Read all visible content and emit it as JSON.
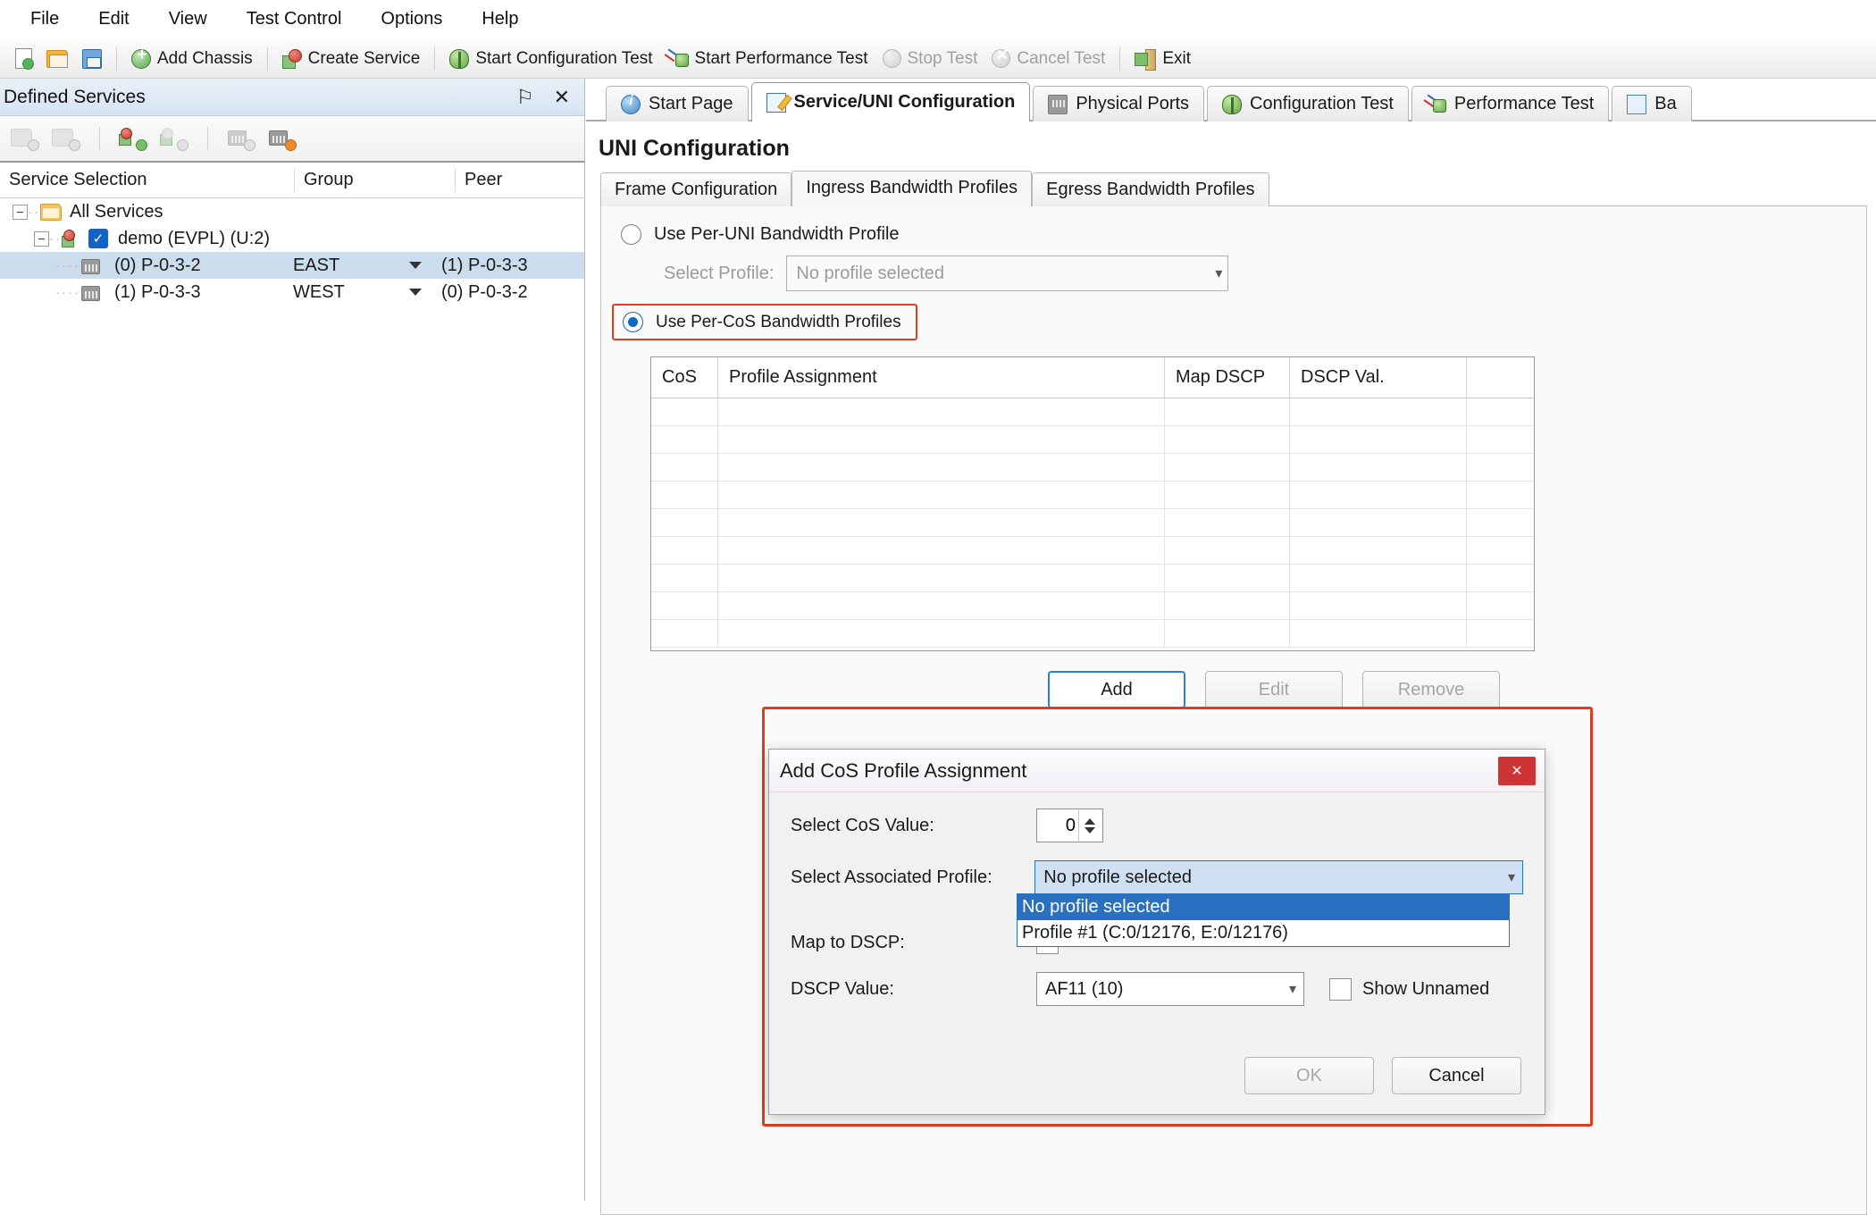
{
  "menubar": {
    "items": [
      "File",
      "Edit",
      "View",
      "Test Control",
      "Options",
      "Help"
    ]
  },
  "toolbar": {
    "items": [
      {
        "label": "",
        "icon": "new-document-icon",
        "enabled": true
      },
      {
        "label": "",
        "icon": "open-folder-icon",
        "enabled": true
      },
      {
        "label": "",
        "icon": "save-icon",
        "enabled": true
      },
      {
        "label": "Add Chassis",
        "icon": "add-chassis-icon",
        "enabled": true
      },
      {
        "label": "Create Service",
        "icon": "create-service-icon",
        "enabled": true
      },
      {
        "label": "Start Configuration Test",
        "icon": "start-configuration-test-icon",
        "enabled": true
      },
      {
        "label": "Start Performance Test",
        "icon": "start-performance-test-icon",
        "enabled": true
      },
      {
        "label": "Stop Test",
        "icon": "stop-test-icon",
        "enabled": false
      },
      {
        "label": "Cancel Test",
        "icon": "cancel-test-icon",
        "enabled": false
      },
      {
        "label": "Exit",
        "icon": "exit-icon",
        "enabled": true
      }
    ]
  },
  "left_panel": {
    "title": "Defined Services",
    "pin_glyph": "⚐",
    "close_glyph": "✕",
    "columns": [
      "Service Selection",
      "Group",
      "Peer"
    ],
    "tree": [
      {
        "label": "All Services",
        "icon": "folder-icon",
        "depth": 0,
        "expanded": true,
        "group": "",
        "peer": "",
        "selected": false
      },
      {
        "label": "demo (EVPL) (U:2)",
        "icon": "service-icon",
        "depth": 1,
        "expanded": true,
        "checked": true,
        "group": "",
        "peer": "",
        "selected": false
      },
      {
        "label": "(0) P-0-3-2",
        "icon": "chassis-icon",
        "depth": 2,
        "group": "EAST",
        "peer": "(1) P-0-3-3",
        "selected": true
      },
      {
        "label": "(1) P-0-3-3",
        "icon": "chassis-icon",
        "depth": 2,
        "group": "WEST",
        "peer": "(0) P-0-3-2",
        "selected": false
      }
    ]
  },
  "tabs": [
    {
      "label": "Start Page",
      "icon": "info-icon",
      "active": false
    },
    {
      "label": "Service/UNI Configuration",
      "icon": "pencil-icon",
      "active": true
    },
    {
      "label": "Physical Ports",
      "icon": "chassis-icon",
      "active": false
    },
    {
      "label": "Configuration Test",
      "icon": "bug-icon",
      "active": false
    },
    {
      "label": "Performance Test",
      "icon": "performance-icon",
      "active": false
    },
    {
      "label": "Ba",
      "icon": "page-icon",
      "active": false
    }
  ],
  "main": {
    "page_title": "UNI Configuration",
    "subtabs": [
      {
        "label": "Frame Configuration",
        "active": false
      },
      {
        "label": "Ingress Bandwidth Profiles",
        "active": true
      },
      {
        "label": "Egress Bandwidth Profiles",
        "active": false
      }
    ],
    "per_uni": {
      "radio_label": "Use Per-UNI Bandwidth Profile",
      "selected": false,
      "select_profile_label": "Select Profile:",
      "select_profile_value": "No profile selected"
    },
    "per_cos": {
      "radio_label": "Use Per-CoS Bandwidth Profiles",
      "selected": true,
      "highlighted": true
    },
    "table": {
      "columns": [
        "CoS",
        "Profile Assignment",
        "Map DSCP",
        "DSCP Val.",
        ""
      ],
      "rows": []
    },
    "buttons": [
      {
        "label": "Add",
        "enabled": true,
        "primary": true
      },
      {
        "label": "Edit",
        "enabled": false,
        "primary": false
      },
      {
        "label": "Remove",
        "enabled": false,
        "primary": false
      }
    ]
  },
  "dialog": {
    "title": "Add CoS Profile Assignment",
    "close_glyph": "×",
    "highlighted": true,
    "cos_value_label": "Select CoS Value:",
    "cos_value": "0",
    "associated_profile_label": "Select Associated Profile:",
    "associated_profile_value": "No profile selected",
    "dropdown_open": true,
    "dropdown_options": [
      {
        "label": "No profile selected",
        "selected": true
      },
      {
        "label": "Profile #1 (C:0/12176, E:0/12176)",
        "selected": false
      }
    ],
    "map_to_dscp_label": "Map to DSCP:",
    "map_to_dscp_checked": false,
    "dscp_value_label": "DSCP Value:",
    "dscp_value": "AF11 (10)",
    "show_unnamed_label": "Show Unnamed",
    "show_unnamed_checked": false,
    "ok_label": "OK",
    "ok_enabled": false,
    "cancel_label": "Cancel"
  },
  "colors": {
    "highlight_red": "#e03c1e",
    "selection_blue": "#2a70c0",
    "tree_selection": "#cbdcec"
  }
}
